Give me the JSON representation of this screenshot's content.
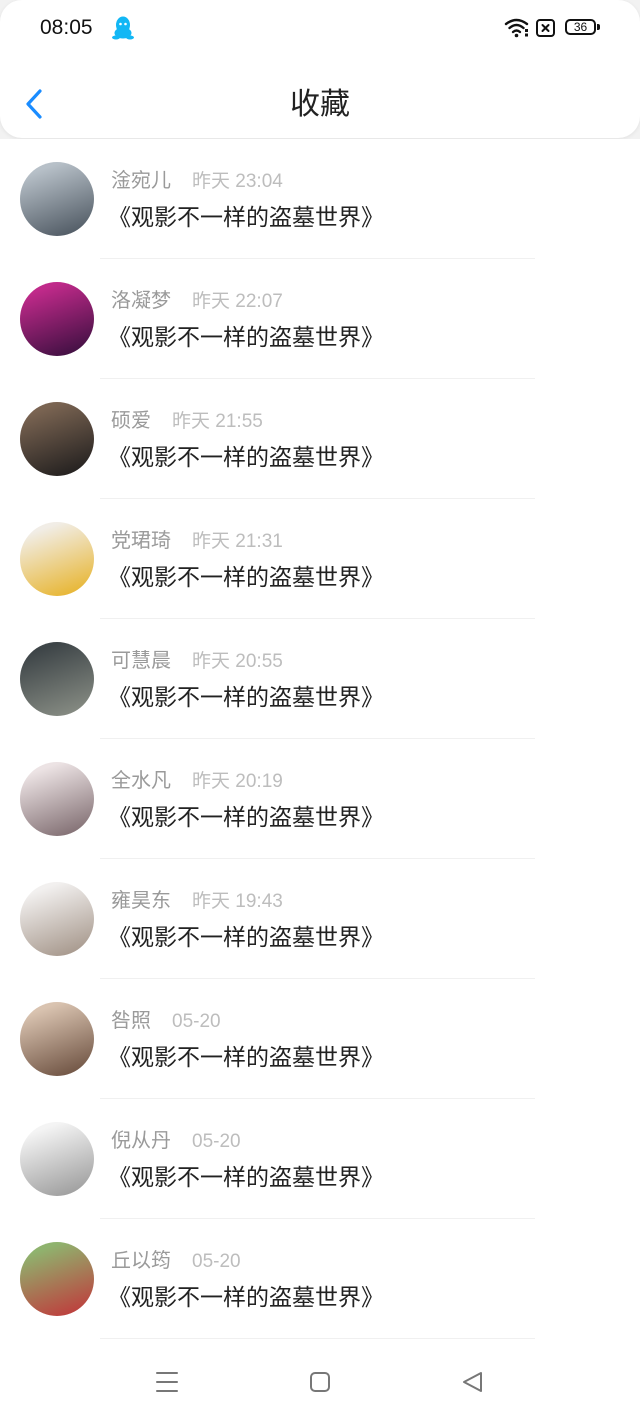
{
  "status_bar": {
    "time": "08:05",
    "battery": "36",
    "icons": [
      "qq-icon",
      "wifi-icon",
      "sim-x-icon",
      "battery-icon"
    ]
  },
  "header": {
    "title": "收藏",
    "back_icon": "chevron-left-icon",
    "accent_color": "#1a8cff"
  },
  "items": [
    {
      "name": "淦宛儿",
      "time": "昨天 23:04",
      "title": "《观影不一样的盗墓世界》",
      "avatar_colors": [
        "#b7c0c8",
        "#4c5660"
      ]
    },
    {
      "name": "洛凝梦",
      "time": "昨天 22:07",
      "title": "《观影不一样的盗墓世界》",
      "avatar_colors": [
        "#c02a8a",
        "#3a0f3f"
      ]
    },
    {
      "name": "硕爱",
      "time": "昨天 21:55",
      "title": "《观影不一样的盗墓世界》",
      "avatar_colors": [
        "#7a6452",
        "#1f1d1d"
      ]
    },
    {
      "name": "党珺琦",
      "time": "昨天 21:31",
      "title": "《观影不一样的盗墓世界》",
      "avatar_colors": [
        "#f1ede6",
        "#e7b32a"
      ]
    },
    {
      "name": "可慧晨",
      "time": "昨天 20:55",
      "title": "《观影不一样的盗墓世界》",
      "avatar_colors": [
        "#3e4548",
        "#8a8f86"
      ]
    },
    {
      "name": "全水凡",
      "time": "昨天 20:19",
      "title": "《观影不一样的盗墓世界》",
      "avatar_colors": [
        "#ece3e4",
        "#7d6a6e"
      ]
    },
    {
      "name": "雍昊东",
      "time": "昨天 19:43",
      "title": "《观影不一样的盗墓世界》",
      "avatar_colors": [
        "#f2f0ef",
        "#a39488"
      ]
    },
    {
      "name": "咎照",
      "time": "05-20",
      "title": "《观影不一样的盗墓世界》",
      "avatar_colors": [
        "#d9c3b0",
        "#6b4f3f"
      ]
    },
    {
      "name": "倪从丹",
      "time": "05-20",
      "title": "《观影不一样的盗墓世界》",
      "avatar_colors": [
        "#f4f4f4",
        "#9a9a9a"
      ]
    },
    {
      "name": "丘以筠",
      "time": "05-20",
      "title": "《观影不一样的盗墓世界》",
      "avatar_colors": [
        "#8fb36e",
        "#c0393b"
      ]
    }
  ],
  "bottom_nav": {
    "icons": [
      "menu-icon",
      "home-icon",
      "back-icon"
    ],
    "icon_color": "#777777"
  }
}
